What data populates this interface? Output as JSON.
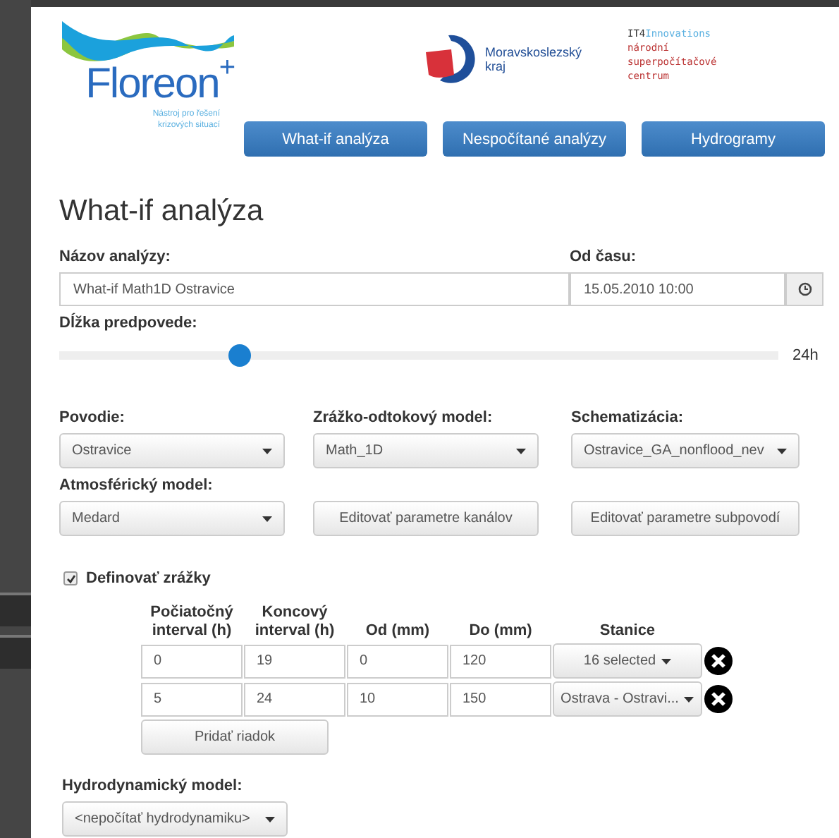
{
  "header": {
    "logo": {
      "name": "Floreon",
      "sup": "+",
      "tagline": "Nástroj pro řešení krizových situací"
    },
    "partner": {
      "line_1": "Moravskoslezský",
      "line_2": "kraj"
    },
    "institute": {
      "lines": [
        {
          "parts": [
            "IT4",
            "Innovations"
          ]
        },
        {
          "parts": [
            "národní"
          ]
        },
        {
          "parts": [
            "superpočítačové"
          ]
        },
        {
          "parts": [
            "centrum"
          ]
        }
      ]
    },
    "nav": [
      "What-if analýza",
      "Nespočítané analýzy",
      "Hydrogramy"
    ]
  },
  "title": "What-if analýza",
  "name_field": {
    "label": "Názov analýzy:",
    "value": "What-if Math1D Ostravice"
  },
  "time_field": {
    "label": "Od času:",
    "value": "15.05.2010 10:00"
  },
  "forecast": {
    "label": "Dĺžka predpovede:",
    "level": 0.25,
    "reading": "24h"
  },
  "selects": [
    {
      "label": "Povodie:",
      "value": "Ostravice"
    },
    {
      "label": "Zrážko-odtokový model:",
      "value": "Math_1D"
    },
    {
      "label": "Schematizácia:",
      "value": "Ostravice_GA_nonflood_nev"
    }
  ],
  "atmo": {
    "label": "Atmosférický model:",
    "value": "Medard"
  },
  "buttons": [
    "Editovať parametre kanálov",
    "Editovať parametre subpovodí"
  ],
  "rain": {
    "label": "Definovať zrážky",
    "checked": true,
    "columns": [
      "Počiatočný interval (h)",
      "Koncový interval (h)",
      "Od (mm)",
      "Do (mm)",
      "Stanice"
    ],
    "rows": [
      {
        "cells": [
          "0",
          "19",
          "0",
          "120"
        ],
        "station": "16 selected"
      },
      {
        "cells": [
          "5",
          "24",
          "10",
          "150"
        ],
        "station": "Ostrava - Ostravi..."
      }
    ],
    "add_button": "Pridať riadok"
  },
  "hydro": {
    "label": "Hydrodynamický model:",
    "value": "<nepočítať hydrodynamiku>"
  }
}
